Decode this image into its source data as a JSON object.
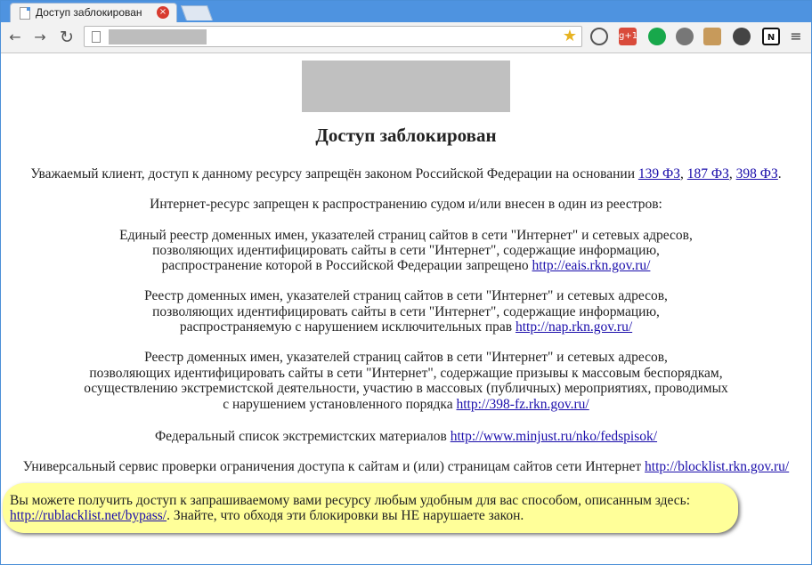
{
  "browser": {
    "tab_title": "Доступ заблокирован",
    "close_symbol": "×",
    "back_symbol": "←",
    "forward_symbol": "→",
    "reload_symbol": "↻",
    "bookmark_symbol": "★",
    "ext_labels": [
      "g+1",
      "N",
      "≡"
    ]
  },
  "page": {
    "heading": "Доступ заблокирован",
    "intro": "Уважаемый клиент, доступ к данному ресурсу запрещён законом Российской Федерации на основании ",
    "laws": [
      "139 ФЗ",
      "187 ФЗ",
      "398 ФЗ"
    ],
    "law_separator": ", ",
    "law_end": ".",
    "sub_intro": "Интернет-ресурс запрещен к распространению судом и/или внесен в один из реестров:",
    "registry1": {
      "line1": "Единый реестр доменных имен, указателей страниц сайтов в сети \"Интернет\" и сетевых адресов,",
      "line2": "позволяющих идентифицировать сайты в сети \"Интернет\", содержащие информацию,",
      "line3": "распространение которой в Российской Федерации запрещено ",
      "link": "http://eais.rkn.gov.ru/"
    },
    "registry2": {
      "line1": "Реестр доменных имен, указателей страниц сайтов в сети \"Интернет\" и сетевых адресов,",
      "line2": "позволяющих идентифицировать сайты в сети \"Интернет\", содержащие информацию,",
      "line3": "распространяемую с нарушением исключительных прав ",
      "link": "http://nap.rkn.gov.ru/"
    },
    "registry3": {
      "line1": "Реестр доменных имен, указателей страниц сайтов в сети \"Интернет\" и сетевых адресов,",
      "line2": "позволяющих идентифицировать сайты в сети \"Интернет\", содержащие призывы к массовым беспорядкам,",
      "line3": "осуществлению экстремистской деятельности, участию в массовых (публичных) мероприятиях, проводимых",
      "line4": "с нарушением установленного порядка ",
      "link": "http://398-fz.rkn.gov.ru/"
    },
    "federal_list": {
      "text": "Федеральный список экстремистских материалов ",
      "link": "http://www.minjust.ru/nko/fedspisok/"
    },
    "service": {
      "text": "Универсальный сервис проверки ограничения доступа к сайтам и (или) страницам сайтов сети Интернет ",
      "link": "http://blocklist.rkn.gov.ru/"
    },
    "notice": {
      "line1": "Вы можете получить доступ к запрашиваемому вами ресурсу любым удобным для вас способом, описанным здесь:",
      "link": "http://rublacklist.net/bypass/",
      "line2_rest": ". Знайте, что обходя эти блокировки вы НЕ нарушаете закон."
    }
  }
}
